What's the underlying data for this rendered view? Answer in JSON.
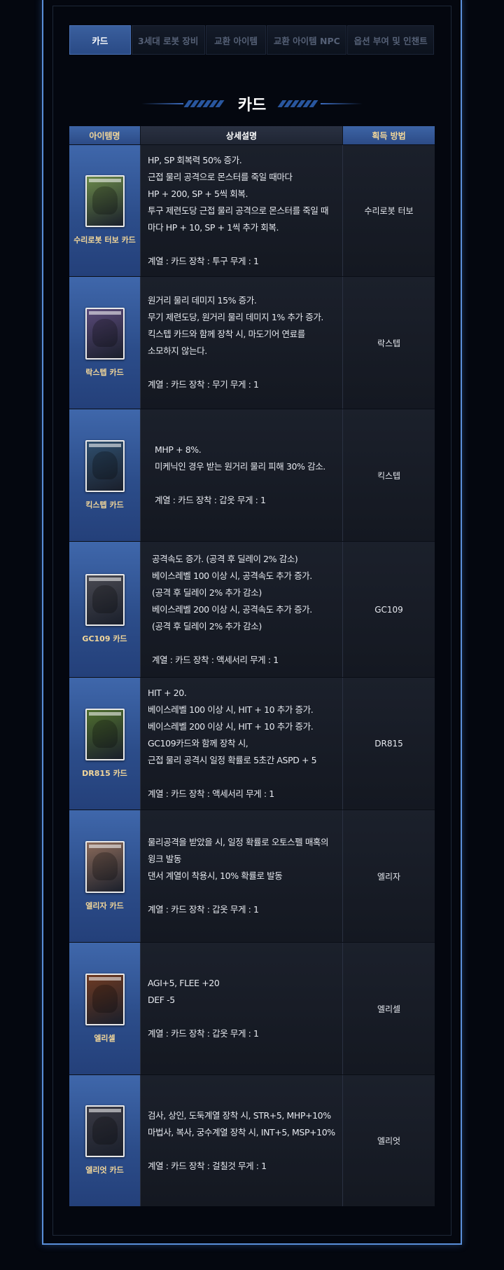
{
  "tabs": [
    {
      "label": "카드",
      "active": true
    },
    {
      "label": "3세대 로봇 장비",
      "active": false
    },
    {
      "label": "교환 아이템",
      "active": false
    },
    {
      "label": "교환 아이템 NPC",
      "active": false
    },
    {
      "label": "옵션 부여 및 인챈트",
      "active": false
    }
  ],
  "page_title": "카드",
  "table": {
    "headers": {
      "name": "아이템명",
      "desc": "상세설명",
      "get": "획득 방법"
    },
    "rows": [
      {
        "name": "수리로봇 터보 카드",
        "desc": [
          "HP, SP 회복력 50% 증가.",
          "근접 물리 공격으로 몬스터를 죽일 때마다",
          "HP + 200, SP + 5씩 회복.",
          "투구 제련도당 근접 물리 공격으로 몬스터를 죽일 때",
          "마다 HP + 10, SP + 1씩 추가 회복.",
          "",
          "계열 : 카드   장착 : 투구   무게 : 1"
        ],
        "get": "수리로봇 터보",
        "card_color": "#6b8a4a"
      },
      {
        "name": "락스텝 카드",
        "desc": [
          "원거리 물리 데미지 15% 증가.",
          "무기 제련도당, 원거리 물리 데미지 1% 추가 증가.",
          "킥스텝 카드와 함께 장착 시, 마도기어 연료를",
          "소모하지 않는다.",
          "",
          "계열 : 카드   장착 : 무기   무게 : 1"
        ],
        "get": "락스텝",
        "card_color": "#5a4a7a"
      },
      {
        "name": "킥스텝 카드",
        "desc": [
          "MHP + 8%.",
          "미케닉인 경우 받는 원거리 물리 피해 30% 감소.",
          "",
          "계열 : 카드   장착 : 갑옷   무게 : 1"
        ],
        "get": "킥스텝",
        "card_color": "#2f4f6e"
      },
      {
        "name": "GC109 카드",
        "desc": [
          "공격속도 증가. (공격 후 딜레이 2% 감소)",
          "베이스레벨 100 이상 시, 공격속도 추가 증가.",
          "(공격 후 딜레이 2% 추가 감소)",
          "베이스레벨 200 이상 시, 공격속도 추가 증가.",
          "(공격 후 딜레이 2% 추가 감소)",
          "",
          "계열 : 카드   장착 : 액세서리   무게 : 1"
        ],
        "get": "GC109",
        "card_color": "#4a4a52"
      },
      {
        "name": "DR815 카드",
        "desc": [
          "HIT + 20.",
          "베이스레벨 100 이상 시, HIT + 10 추가 증가.",
          "베이스레벨 200 이상 시, HIT + 10 추가 증가.",
          "GC109카드와 함께 장착 시,",
          "근접 물리 공격시 일정 확률로 5초간 ASPD + 5",
          "",
          "계열 : 카드   장착 : 액세서리   무게 : 1"
        ],
        "get": "DR815",
        "card_color": "#4f6e2f"
      },
      {
        "name": "엘리자 카드",
        "desc": [
          "물리공격을 받았을 시, 일정 확률로 오토스펠 매혹의",
          "윙크 발동",
          "댄서 계열이 착용시, 10% 확률로 발동",
          "",
          "계열 : 카드   장착 : 갑옷   무게 : 1"
        ],
        "get": "엘리자",
        "card_color": "#8a6a5a"
      },
      {
        "name": "엘리셀",
        "desc": [
          "AGI+5, FLEE +20",
          "DEF -5",
          "",
          "계열 : 카드   장착 : 갑옷   무게 : 1"
        ],
        "get": "엘리셀",
        "card_color": "#6e3a22"
      },
      {
        "name": "엘리엇 카드",
        "desc": [
          "검사, 상인, 도둑계열 장착 시, STR+5, MHP+10%",
          "마법사, 복사, 궁수계열 장착 시, INT+5, MSP+10%",
          "",
          "계열 : 카드   장착 : 걸칠것   무게 : 1"
        ],
        "get": "엘리엇",
        "card_color": "#3a3a44"
      }
    ]
  }
}
